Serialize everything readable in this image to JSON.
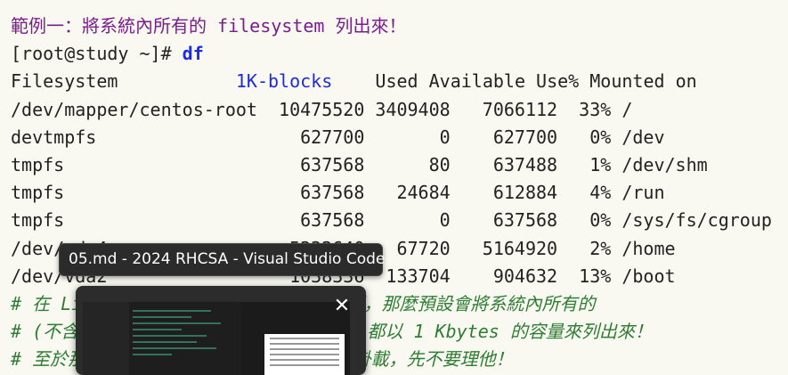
{
  "doc": {
    "title": "範例一：將系統內所有的 filesystem 列出來！",
    "prompt": "[root@study ~]# ",
    "command": "df",
    "header_fs": "Filesystem           ",
    "header_blocks": "1K-blocks",
    "header_rest": "    Used Available Use% Mounted on",
    "rows": [
      "/dev/mapper/centos-root  10475520 3409408   7066112  33% /",
      "devtmpfs                   627700       0    627700   0% /dev",
      "tmpfs                      637568      80    637488   1% /dev/shm",
      "tmpfs                      637568   24684    612884   4% /run",
      "tmpfs                      637568       0    637568   0% /sys/fs/cgroup",
      "/dev/vda4                 5232640   67720   5164920   2% /home",
      "/dev/vda2                 1038336  133704    904632  13% /boot"
    ],
    "comments": [
      "# 在 Linux 底下如果 df 沒有加任何選項，那麼預設會將系統內所有的",
      "# (不含特殊記憶體內的檔案系統與 swap) 都以 1 Kbytes 的容量來列出來！",
      "# 至於那個 /dev/shm 是與記憶體有關的掛載，先不要理他！"
    ]
  },
  "taskbar_preview": {
    "tooltip": "05.md - 2024 RHCSA - Visual Studio Code",
    "close_glyph": "✕"
  }
}
